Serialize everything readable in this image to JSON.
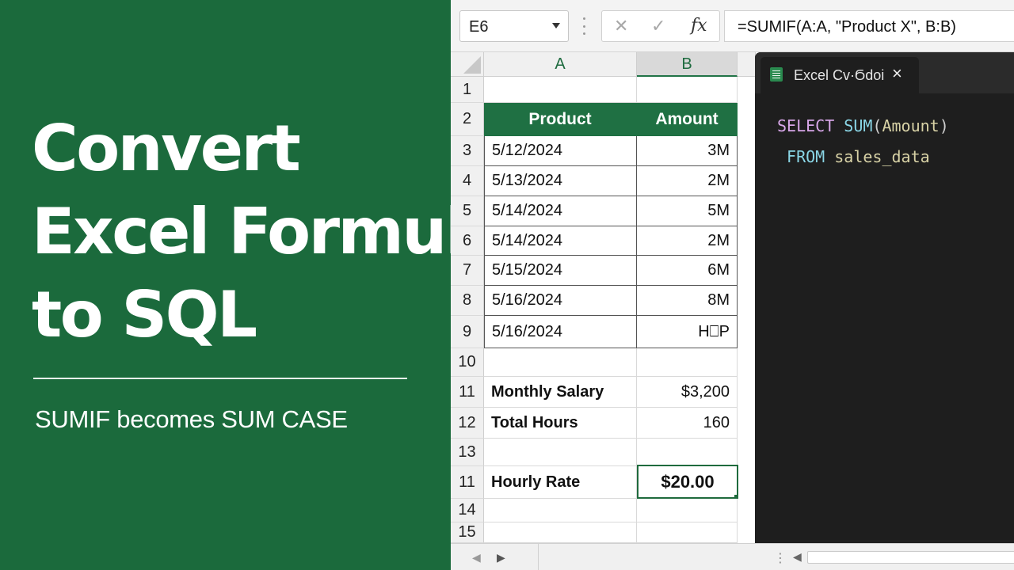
{
  "promo": {
    "title_lines": [
      "Convert",
      "Excel Formulas",
      "to SQL"
    ],
    "subtitle": "SUMIF becomes SUM CASE",
    "background_color": "#1b6a3c"
  },
  "formula_bar": {
    "name_box": "E6",
    "cancel_icon": "✕",
    "enter_icon": "✓",
    "fx_label": "fx",
    "formula": "=SUMIF(A:A, \"Product X\", B:B)"
  },
  "sheet": {
    "columns": [
      "A",
      "B"
    ],
    "row_numbers": [
      "1",
      "2",
      "3",
      "4",
      "5",
      "6",
      "7",
      "8",
      "9",
      "10",
      "11",
      "12",
      "13",
      "11",
      "14",
      "15"
    ],
    "table_header": {
      "product": "Product",
      "amount": "Amount"
    },
    "table_rows": [
      {
        "product": "5/12/2024",
        "amount": "3M"
      },
      {
        "product": "5/13/2024",
        "amount": "2M"
      },
      {
        "product": "5/14/2024",
        "amount": "5M"
      },
      {
        "product": "5/14/2024",
        "amount": "2M"
      },
      {
        "product": "5/15/2024",
        "amount": "6M"
      },
      {
        "product": "5/16/2024",
        "amount": "8M"
      },
      {
        "product": "5/16/2024",
        "amount": "H⎕P"
      }
    ],
    "monthly_salary": {
      "label": "Monthly Salary",
      "value": "$3,200"
    },
    "total_hours": {
      "label": "Total Hours",
      "value": "160"
    },
    "hourly_rate": {
      "label": "Hourly Rate",
      "value": "$20.00"
    },
    "accent_color": "#1f7043"
  },
  "editor": {
    "tab_label": "Excel Cv·Ϭdoi",
    "close_icon": "×",
    "code": {
      "l1_kw": "SELECT",
      "l1_fn": "SUM",
      "l1_open": "(",
      "l1_arg": "Amount",
      "l1_close": ")",
      "l2_kw": "FROM",
      "l2_table": "sales_data"
    }
  },
  "bottom": {
    "prev_icon": "◀",
    "next_icon": "▶",
    "more_icon": "⋮",
    "scroll_left_icon": "◀"
  }
}
